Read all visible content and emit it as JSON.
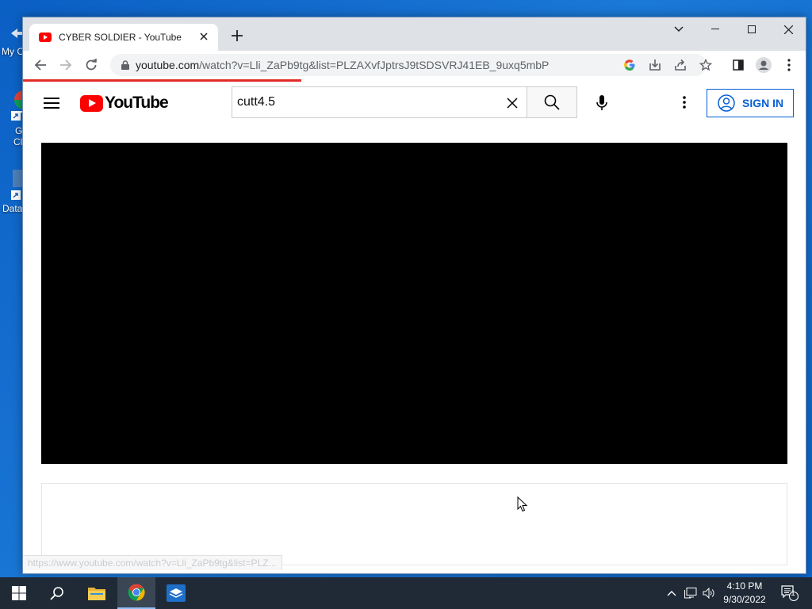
{
  "desktop": {
    "icons": [
      {
        "label": "My C",
        "top": "58"
      },
      {
        "label": "G",
        "top": "158"
      },
      {
        "label": "Cl",
        "top": "172"
      },
      {
        "label": "Data",
        "top": "256"
      }
    ]
  },
  "tab": {
    "title": "CYBER SOLDIER - YouTube"
  },
  "toolbar": {
    "url_host": "youtube.com",
    "url_rest": "/watch?v=Lli_ZaPb9tg&list=PLZAXvfJptrsJ9tSDSVRJ41EB_9uxq5mbP"
  },
  "youtube": {
    "logo_text": "YouTube",
    "search_value": "cutt4.5",
    "search_placeholder": "Search",
    "signin_label": "SIGN IN"
  },
  "status_bar": {
    "url": "https://www.youtube.com/watch?v=Lli_ZaPb9tg&list=PLZ..."
  },
  "taskbar": {
    "time": "4:10 PM",
    "date": "9/30/2022",
    "notification_count": "1"
  },
  "colors": {
    "accent_red": "#ff0000",
    "signin_blue": "#065fd4",
    "desktop_blue": "#1a78d6",
    "taskbar": "#1f2a36"
  }
}
